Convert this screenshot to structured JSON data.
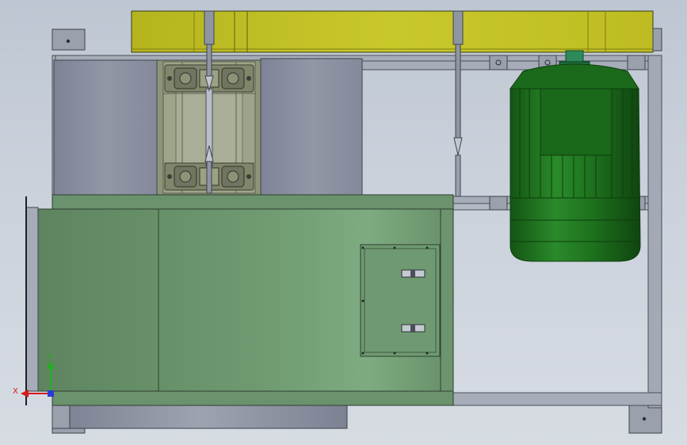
{
  "triad": {
    "x_label": "X",
    "y_label": "Y"
  },
  "colors": {
    "background": "#c9d0da",
    "frame": "#9aa1ad",
    "frame_dark": "#4a4f59",
    "housing_green": "#6e9870",
    "guard_yellow": "#c7c629",
    "motor_green": "#1f6f1f",
    "panel_gray": "#8c92a3",
    "axis_x": "#d41b1b",
    "axis_y": "#20b020",
    "axis_z": "#2a3bd6"
  }
}
